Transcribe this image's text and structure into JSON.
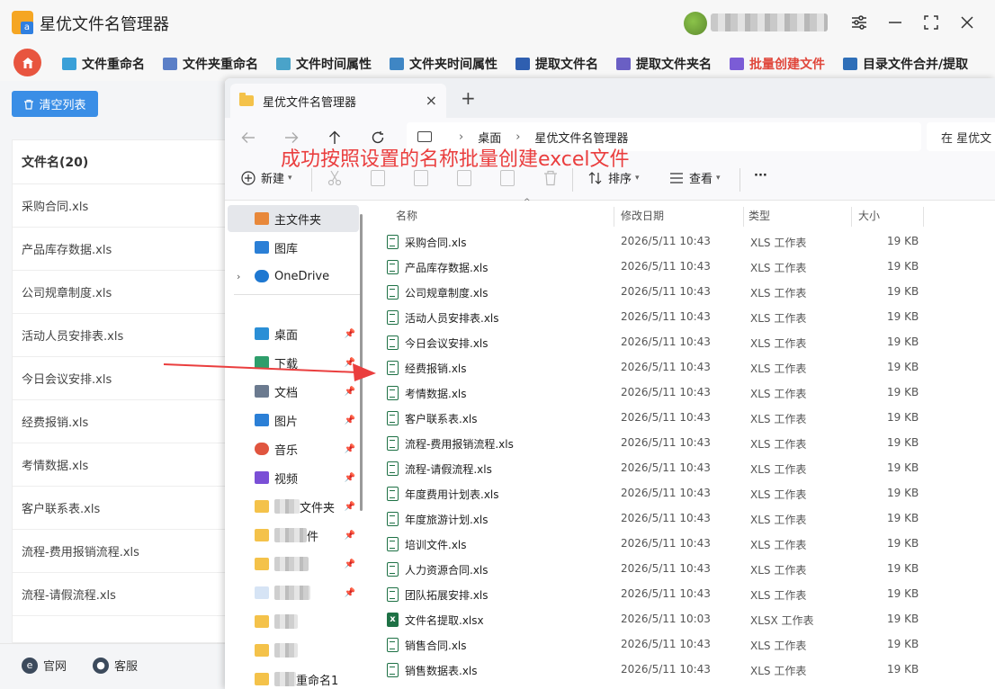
{
  "app": {
    "title": "星优文件名管理器",
    "logo_text": "a",
    "nav": [
      {
        "label": "文件重命名",
        "color": "#3aa0d8"
      },
      {
        "label": "文件夹重命名",
        "color": "#5b7fc7"
      },
      {
        "label": "文件时间属性",
        "color": "#4aa3c9"
      },
      {
        "label": "文件夹时间属性",
        "color": "#3f86c4"
      },
      {
        "label": "提取文件名",
        "color": "#2f5fb0"
      },
      {
        "label": "提取文件夹名",
        "color": "#6a5fc4"
      },
      {
        "label": "批量创建文件",
        "color": "#7b5cd6"
      },
      {
        "label": "目录文件合并/提取",
        "color": "#2f6fb8"
      }
    ],
    "active_nav_color": "#e0463a",
    "clear_button": "清空列表",
    "file_header": "文件名(20)",
    "files": [
      "采购合同.xls",
      "产品库存数据.xls",
      "公司规章制度.xls",
      "活动人员安排表.xls",
      "今日会议安排.xls",
      "经费报销.xls",
      "考情数据.xls",
      "客户联系表.xls",
      "流程-费用报销流程.xls",
      "流程-请假流程.xls"
    ],
    "footer": {
      "site": "官网",
      "service": "客服"
    }
  },
  "explorer": {
    "tab_title": "星优文件名管理器",
    "tab_close": "×",
    "tab_new": "+",
    "breadcrumb": [
      "桌面",
      "星优文件名管理器"
    ],
    "search_placeholder": "在 星优文",
    "toolbar": {
      "new": "新建",
      "sort": "排序",
      "view": "查看",
      "more": "···"
    },
    "annotation": "成功按照设置的名称批量创建excel文件",
    "annotation_color": "#ea3e3e",
    "sidebar": {
      "home": "主文件夹",
      "gallery": "图库",
      "onedrive": "OneDrive",
      "quick": [
        {
          "label": "桌面",
          "icon": "desktop-icon",
          "color": "#2b8fd6"
        },
        {
          "label": "下载",
          "icon": "download-icon",
          "color": "#2e9e6b"
        },
        {
          "label": "文档",
          "icon": "document-icon",
          "color": "#6b7a8f"
        },
        {
          "label": "图片",
          "icon": "picture-icon",
          "color": "#2b7fd6"
        },
        {
          "label": "音乐",
          "icon": "music-icon",
          "color": "#e0553f"
        },
        {
          "label": "视频",
          "icon": "video-icon",
          "color": "#7a4fd6"
        }
      ],
      "folder_suffix_1": "文件夹",
      "folder_suffix_2": "件",
      "folder_suffix_last": "重命名1"
    },
    "columns": {
      "name": "名称",
      "modified": "修改日期",
      "type": "类型",
      "size": "大小"
    },
    "rows": [
      {
        "name": "采购合同.xls",
        "date": "2026/5/11 10:43",
        "type": "XLS 工作表",
        "size": "19 KB",
        "kind": "xls"
      },
      {
        "name": "产品库存数据.xls",
        "date": "2026/5/11 10:43",
        "type": "XLS 工作表",
        "size": "19 KB",
        "kind": "xls"
      },
      {
        "name": "公司规章制度.xls",
        "date": "2026/5/11 10:43",
        "type": "XLS 工作表",
        "size": "19 KB",
        "kind": "xls"
      },
      {
        "name": "活动人员安排表.xls",
        "date": "2026/5/11 10:43",
        "type": "XLS 工作表",
        "size": "19 KB",
        "kind": "xls"
      },
      {
        "name": "今日会议安排.xls",
        "date": "2026/5/11 10:43",
        "type": "XLS 工作表",
        "size": "19 KB",
        "kind": "xls"
      },
      {
        "name": "经费报销.xls",
        "date": "2026/5/11 10:43",
        "type": "XLS 工作表",
        "size": "19 KB",
        "kind": "xls"
      },
      {
        "name": "考情数据.xls",
        "date": "2026/5/11 10:43",
        "type": "XLS 工作表",
        "size": "19 KB",
        "kind": "xls"
      },
      {
        "name": "客户联系表.xls",
        "date": "2026/5/11 10:43",
        "type": "XLS 工作表",
        "size": "19 KB",
        "kind": "xls"
      },
      {
        "name": "流程-费用报销流程.xls",
        "date": "2026/5/11 10:43",
        "type": "XLS 工作表",
        "size": "19 KB",
        "kind": "xls"
      },
      {
        "name": "流程-请假流程.xls",
        "date": "2026/5/11 10:43",
        "type": "XLS 工作表",
        "size": "19 KB",
        "kind": "xls"
      },
      {
        "name": "年度费用计划表.xls",
        "date": "2026/5/11 10:43",
        "type": "XLS 工作表",
        "size": "19 KB",
        "kind": "xls"
      },
      {
        "name": "年度旅游计划.xls",
        "date": "2026/5/11 10:43",
        "type": "XLS 工作表",
        "size": "19 KB",
        "kind": "xls"
      },
      {
        "name": "培训文件.xls",
        "date": "2026/5/11 10:43",
        "type": "XLS 工作表",
        "size": "19 KB",
        "kind": "xls"
      },
      {
        "name": "人力资源合同.xls",
        "date": "2026/5/11 10:43",
        "type": "XLS 工作表",
        "size": "19 KB",
        "kind": "xls"
      },
      {
        "name": "团队拓展安排.xls",
        "date": "2026/5/11 10:43",
        "type": "XLS 工作表",
        "size": "19 KB",
        "kind": "xls"
      },
      {
        "name": "文件名提取.xlsx",
        "date": "2026/5/11 10:03",
        "type": "XLSX 工作表",
        "size": "19 KB",
        "kind": "xlsx"
      },
      {
        "name": "销售合同.xls",
        "date": "2026/5/11 10:43",
        "type": "XLS 工作表",
        "size": "19 KB",
        "kind": "xls"
      },
      {
        "name": "销售数据表.xls",
        "date": "2026/5/11 10:43",
        "type": "XLS 工作表",
        "size": "19 KB",
        "kind": "xls"
      }
    ]
  }
}
